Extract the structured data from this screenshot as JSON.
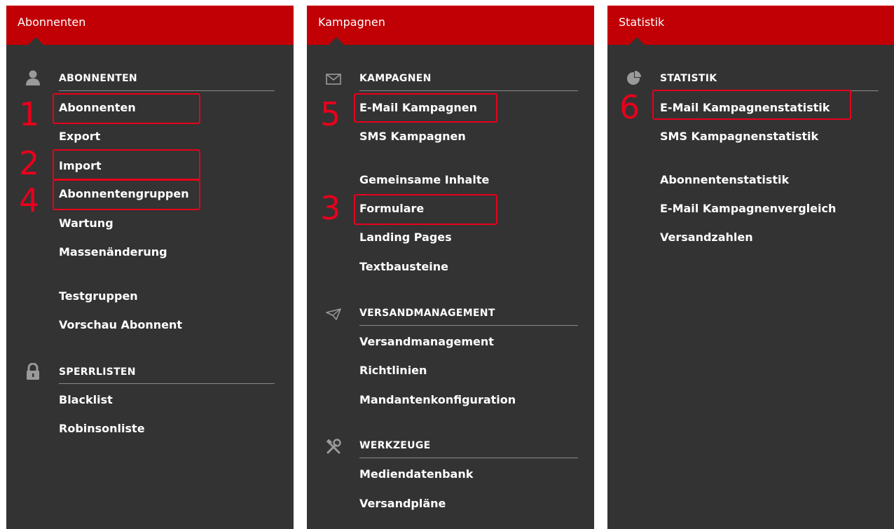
{
  "panels": [
    {
      "title": "Abonnenten",
      "sections": [
        {
          "icon": "user-icon",
          "title": "ABONNENTEN",
          "items": [
            "Abonnenten",
            "Export",
            "Import",
            "Abonnentengruppen",
            "Wartung",
            "Massenänderung",
            "Testgruppen",
            "Vorschau Abonnent"
          ]
        },
        {
          "icon": "lock-icon",
          "title": "SPERRLISTEN",
          "items": [
            "Blacklist",
            "Robinsonliste"
          ]
        }
      ]
    },
    {
      "title": "Kampagnen",
      "sections": [
        {
          "icon": "envelope-icon",
          "title": "KAMPAGNEN",
          "items": [
            "E-Mail Kampagnen",
            "SMS Kampagnen",
            "Gemeinsame Inhalte",
            "Formulare",
            "Landing Pages",
            "Textbausteine"
          ]
        },
        {
          "icon": "paper-plane-icon",
          "title": "VERSANDMANAGEMENT",
          "items": [
            "Versandmanagement",
            "Richtlinien",
            "Mandantenkonfiguration"
          ]
        },
        {
          "icon": "tools-icon",
          "title": "WERKZEUGE",
          "items": [
            "Mediendatenbank",
            "Versandpläne"
          ]
        }
      ]
    },
    {
      "title": "Statistik",
      "sections": [
        {
          "icon": "pie-chart-icon",
          "title": "STATISTIK",
          "items": [
            "E-Mail Kampagnenstatistik",
            "SMS Kampagnenstatistik",
            "Abonnentenstatistik",
            "E-Mail Kampagnenvergleich",
            "Versandzahlen"
          ]
        }
      ]
    }
  ],
  "annotations": [
    "1",
    "2",
    "3",
    "4",
    "5",
    "6"
  ],
  "colors": {
    "header": "#c10006",
    "panel": "#333333",
    "highlight": "#e8001c",
    "text": "#ffffff"
  }
}
